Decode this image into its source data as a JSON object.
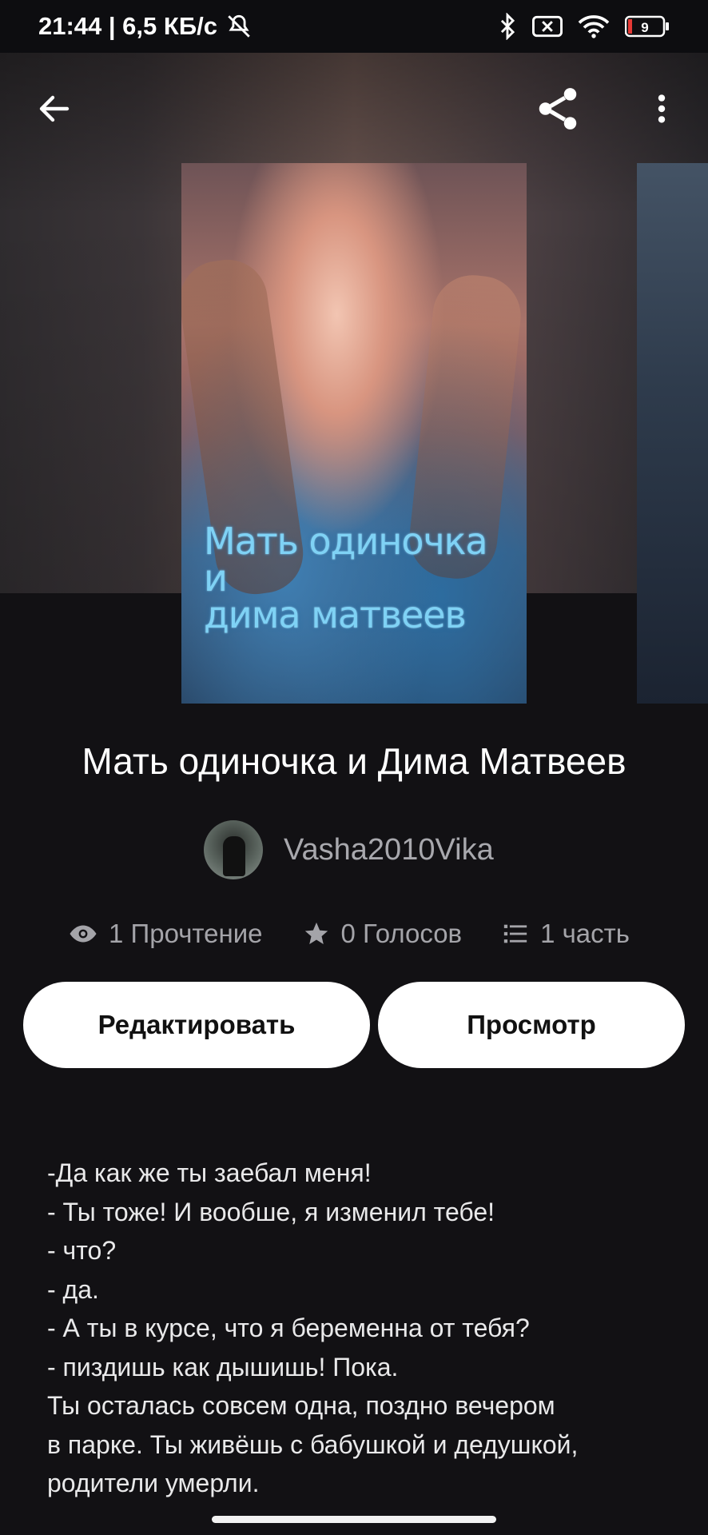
{
  "status_bar": {
    "time_speed": "21:44 | 6,5 КБ/с",
    "battery": "9",
    "icons": [
      "mute-icon",
      "bluetooth-icon",
      "sim-x-icon",
      "wifi-icon",
      "battery-icon"
    ]
  },
  "topbar": {
    "icons": [
      "arrow-back-icon",
      "share-icon",
      "more-vert-icon"
    ]
  },
  "cover": {
    "title_lines": [
      "Мать одиночка",
      "и",
      "дима матвеев"
    ]
  },
  "book": {
    "title": "Мать одиночка и Дима Матвеев",
    "author": "Vasha2010Vika",
    "stats": {
      "reads": "1 Прочтение",
      "votes": "0 Голосов",
      "parts": "1 часть"
    }
  },
  "actions": {
    "edit_label": "Редактировать",
    "view_label": "Просмотр"
  },
  "description": {
    "lines": [
      "-Да как же ты заебал меня!",
      "- Ты тоже! И вообше, я изменил тебе!",
      "- что?",
      "- да.",
      "- А ты в курсе, что я беременна от тебя?",
      "- пиздишь как дышишь! Пока.",
      "Ты осталась совсем одна, поздно вечером",
      "в парке. Ты живёшь с бабушкой и дедушкой,",
      "родители умерли."
    ]
  },
  "colors": {
    "background": "#121114",
    "button_bg": "#ffffff",
    "muted_text": "#a4a4a9",
    "cover_title": "#7fd2f5"
  }
}
